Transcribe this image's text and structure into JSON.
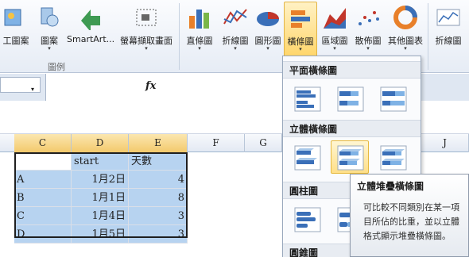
{
  "ribbon": {
    "buttons": [
      {
        "label": "工圖案",
        "icon": "clip-art-icon"
      },
      {
        "label": "圖案",
        "icon": "shapes-icon"
      },
      {
        "label": "SmartArt...",
        "icon": "smartart-icon"
      },
      {
        "label": "螢幕擷取畫面",
        "icon": "screenshot-icon"
      },
      {
        "label": "直條圖",
        "icon": "column-chart-icon"
      },
      {
        "label": "折線圖",
        "icon": "line-chart-icon"
      },
      {
        "label": "圓形圖",
        "icon": "pie-chart-icon"
      },
      {
        "label": "橫條圖",
        "icon": "bar-chart-icon"
      },
      {
        "label": "區域圖",
        "icon": "area-chart-icon"
      },
      {
        "label": "散佈圖",
        "icon": "scatter-chart-icon"
      },
      {
        "label": "其他圖表",
        "icon": "other-charts-icon"
      },
      {
        "label": "折線圖",
        "icon": "sparkline-line-icon"
      }
    ],
    "dropdown_arrow": "▾",
    "group_label": "圖例"
  },
  "formula_bar": {
    "fx_label": "fx",
    "namebox_arrow": "▾"
  },
  "sheet": {
    "columns": [
      "C",
      "D",
      "E",
      "F",
      "G",
      "J"
    ],
    "rows": [
      [
        "",
        "start",
        "天數"
      ],
      [
        "A",
        "1月2日",
        "4"
      ],
      [
        "B",
        "1月1日",
        "8"
      ],
      [
        "C",
        "1月4日",
        "3"
      ],
      [
        "D",
        "1月5日",
        "3"
      ]
    ]
  },
  "menu": {
    "sections": [
      "平面橫條圖",
      "立體橫條圖",
      "圓柱圖",
      "圓錐圖"
    ]
  },
  "tooltip": {
    "title": "立體堆疊橫條圖",
    "body": "可比較不同類別在某一項目所佔的比重，並以立體格式顯示堆疊橫條圖。"
  },
  "colors": {
    "bar_orange": "#e8802a",
    "bar_blue": "#3a6fb8",
    "selection_fill": "#b7d3f0",
    "active_button": "#ffd66b"
  }
}
